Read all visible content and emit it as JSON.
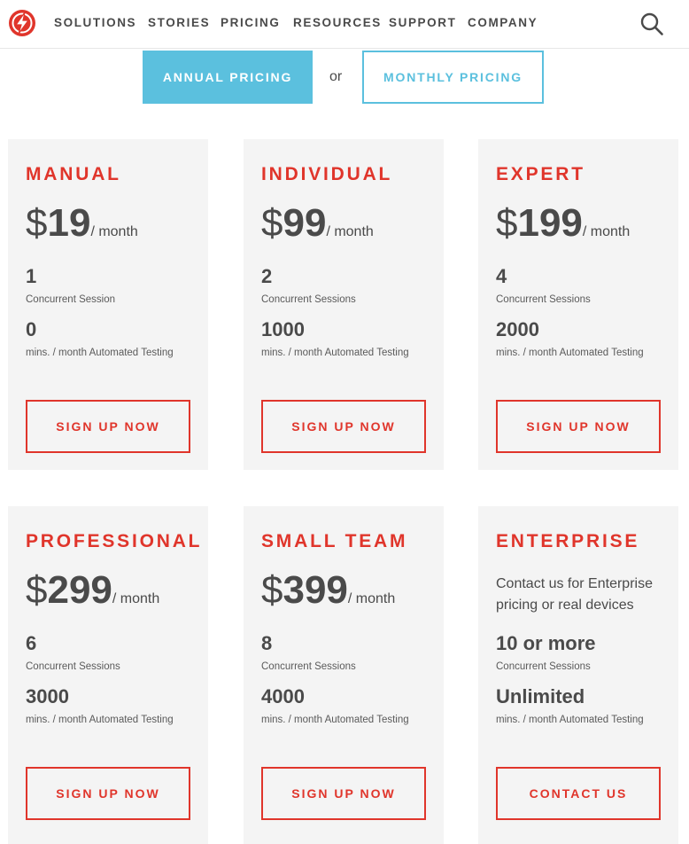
{
  "colors": {
    "accent": "#e0352b",
    "toggle": "#5bc0de",
    "card_bg": "#f4f4f4",
    "text": "#4a4a4a"
  },
  "nav": {
    "logo_icon": "lightning-circle-logo",
    "items": [
      "SOLUTIONS",
      "STORIES",
      "PRICING",
      "RESOURCES",
      "SUPPORT",
      "COMPANY"
    ],
    "search_icon": "search-icon"
  },
  "toggle": {
    "annual": "ANNUAL PRICING",
    "or": "or",
    "monthly": "MONTHLY PRICING"
  },
  "plans": [
    {
      "title": "MANUAL",
      "currency": "$",
      "price": "19",
      "per": "/ month",
      "sessions": "1",
      "sessions_label": "Concurrent Session",
      "minutes": "0",
      "minutes_label": "mins. / month Automated Testing",
      "cta": "SIGN UP NOW"
    },
    {
      "title": "INDIVIDUAL",
      "currency": "$",
      "price": "99",
      "per": "/ month",
      "sessions": "2",
      "sessions_label": "Concurrent Sessions",
      "minutes": "1000",
      "minutes_label": "mins. / month Automated Testing",
      "cta": "SIGN UP NOW"
    },
    {
      "title": "EXPERT",
      "currency": "$",
      "price": "199",
      "per": "/ month",
      "sessions": "4",
      "sessions_label": "Concurrent Sessions",
      "minutes": "2000",
      "minutes_label": "mins. / month Automated Testing",
      "cta": "SIGN UP NOW"
    },
    {
      "title": "PROFESSIONAL",
      "currency": "$",
      "price": "299",
      "per": "/ month",
      "sessions": "6",
      "sessions_label": "Concurrent Sessions",
      "minutes": "3000",
      "minutes_label": "mins. / month Automated Testing",
      "cta": "SIGN UP NOW"
    },
    {
      "title": "SMALL TEAM",
      "currency": "$",
      "price": "399",
      "per": "/ month",
      "sessions": "8",
      "sessions_label": "Concurrent Sessions",
      "minutes": "4000",
      "minutes_label": "mins. / month Automated Testing",
      "cta": "SIGN UP NOW"
    },
    {
      "title": "ENTERPRISE",
      "contact_text": "Contact us for Enterprise pricing or real devices",
      "sessions": "10 or more",
      "sessions_label": "Concurrent Sessions",
      "minutes": "Unlimited",
      "minutes_label": "mins. / month Automated Testing",
      "cta": "CONTACT US"
    }
  ]
}
